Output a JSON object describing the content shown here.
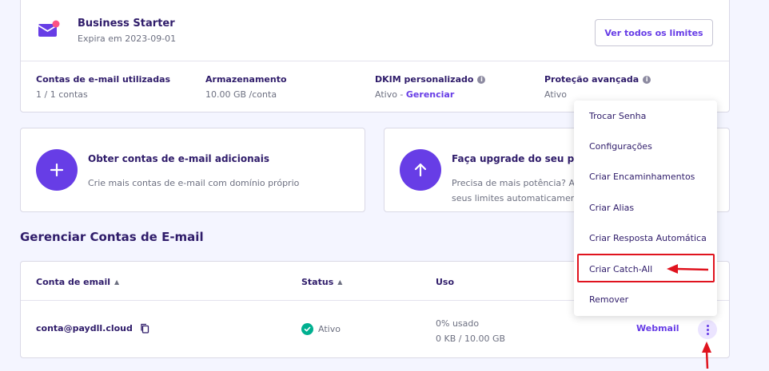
{
  "plan": {
    "title": "Business Starter",
    "expires": "Expira em 2023-09-01",
    "view_limits_button": "Ver todos os limites",
    "stats": [
      {
        "label": "Contas de e-mail utilizadas",
        "value": "1 / 1 contas"
      },
      {
        "label": "Armazenamento",
        "value": "10.00 GB /conta"
      },
      {
        "label": "DKIM personalizado",
        "value": "Ativo - ",
        "link": "Gerenciar"
      },
      {
        "label": "Proteção avançada",
        "value": "Ativo"
      }
    ]
  },
  "promo_cards": [
    {
      "title": "Obter contas de e-mail adicionais",
      "desc": "Crie mais contas de e-mail com domínio próprio",
      "icon": "plus-icon"
    },
    {
      "title": "Faça upgrade do seu plano",
      "desc_line1": "Precisa de mais potência? Ao",
      "desc_line2": "seus limites automaticamente",
      "icon": "arrow-up-icon"
    }
  ],
  "section_title": "Gerenciar Contas de E-mail",
  "table": {
    "headers": {
      "email": "Conta de email",
      "status": "Status",
      "usage": "Uso"
    },
    "row": {
      "email": "conta@paydll.cloud",
      "status": "Ativo",
      "usage_percent": "0% usado",
      "usage_amount": "0 KB / 10.00 GB",
      "webmail": "Webmail"
    }
  },
  "menu": {
    "items": [
      "Trocar Senha",
      "Configurações",
      "Criar Encaminhamentos",
      "Criar Alias",
      "Criar Resposta Automática",
      "Criar Catch-All",
      "Remover"
    ]
  },
  "colors": {
    "primary": "#673de6",
    "text_dark": "#2f1c6a",
    "text_muted": "#6d7081",
    "success": "#00b090",
    "annotation_red": "#e0131e",
    "background": "#f4f5ff"
  }
}
